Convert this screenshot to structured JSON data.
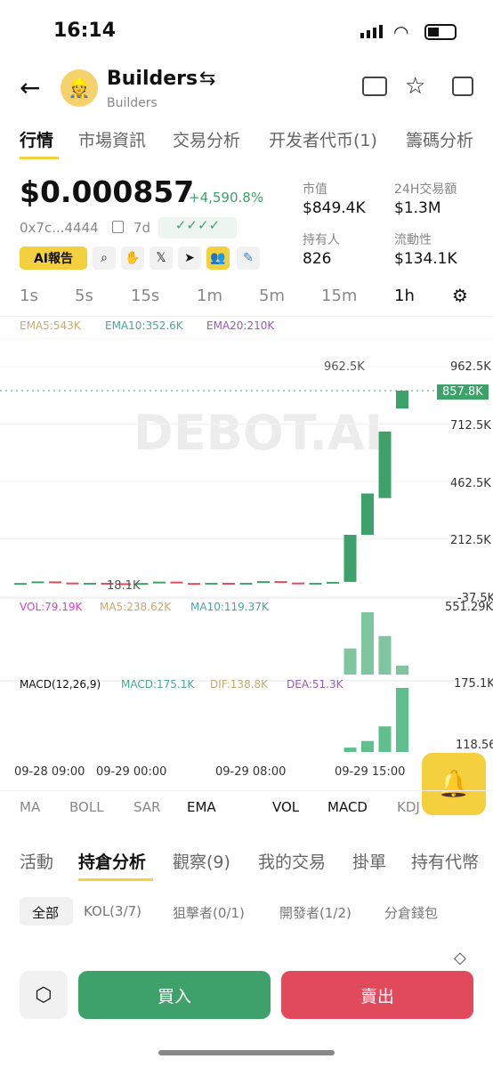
{
  "status": {
    "time": "16:14"
  },
  "header": {
    "title": "Builders",
    "subtitle": "Builders"
  },
  "tabs": [
    "行情",
    "市場資訊",
    "交易分析",
    "开发者代币(1)",
    "籌碼分析"
  ],
  "price": {
    "value": "$0.000857",
    "change": "+4,590.8%",
    "address": "0x7c...4444",
    "age": "7d"
  },
  "stats": {
    "mcap_label": "市值",
    "mcap": "$849.4K",
    "vol_label": "24H交易額",
    "vol": "$1.3M",
    "holders_label": "持有人",
    "holders": "826",
    "liq_label": "流動性",
    "liq": "$134.1K"
  },
  "ai_report": "AI報告",
  "intervals": [
    "1s",
    "5s",
    "15s",
    "1m",
    "5m",
    "15m",
    "1h"
  ],
  "chart": {
    "ema5": "EMA5:543K",
    "ema10": "EMA10:352.6K",
    "ema20": "EMA20:210K",
    "watermark": "DEBOT.AI",
    "yticks": [
      "962.5K",
      "712.5K",
      "462.5K",
      "212.5K",
      "-37.5K"
    ],
    "current": "857.8K",
    "high_label": "962.5K",
    "low_label": "18.1K",
    "vol_legend": "VOL:79.19K",
    "vol_ma5": "MA5:238.62K",
    "vol_ma10": "MA10:119.37K",
    "vol_max": "551.29K",
    "macd": "MACD(12,26,9)",
    "macd_val": "MACD:175.1K",
    "dif": "DIF:138.8K",
    "dea": "DEA:51.3K",
    "macd_max": "175.1K",
    "macd_min": "118.56",
    "xticks": [
      "09-28 09:00",
      "09-29 00:00",
      "09-29 08:00",
      "09-29 15:00"
    ]
  },
  "chart_data": {
    "type": "candlestick",
    "unit": "market cap",
    "candles": [
      {
        "o": 18,
        "c": 20
      },
      {
        "o": 20,
        "c": 27
      },
      {
        "o": 27,
        "c": 22
      },
      {
        "o": 22,
        "c": 18.1
      },
      {
        "o": 18.1,
        "c": 21
      },
      {
        "o": 21,
        "c": 19
      },
      {
        "o": 19,
        "c": 18.5
      },
      {
        "o": 18.5,
        "c": 20
      },
      {
        "o": 20,
        "c": 26
      },
      {
        "o": 26,
        "c": 20
      },
      {
        "o": 20,
        "c": 19
      },
      {
        "o": 19,
        "c": 21
      },
      {
        "o": 21,
        "c": 19
      },
      {
        "o": 19,
        "c": 21
      },
      {
        "o": 21,
        "c": 28
      },
      {
        "o": 28,
        "c": 22
      },
      {
        "o": 22,
        "c": 20
      },
      {
        "o": 20,
        "c": 21
      },
      {
        "o": 21,
        "c": 25
      },
      {
        "o": 25,
        "c": 230
      },
      {
        "o": 230,
        "c": 410
      },
      {
        "o": 390,
        "c": 680
      },
      {
        "o": 780,
        "c": 857.8
      }
    ],
    "volume": [
      0,
      0,
      0,
      0,
      0,
      0,
      0,
      0,
      0,
      0,
      0,
      0,
      0,
      0,
      0,
      0,
      0,
      0,
      0,
      231,
      551.29,
      341,
      79.19
    ],
    "macd": [
      0,
      0,
      0,
      0,
      0,
      0,
      0,
      0,
      0,
      0,
      0,
      0,
      0,
      0,
      0,
      0,
      0,
      0,
      0,
      12,
      30,
      70,
      175.1
    ],
    "ylim": [
      -37.5,
      962.5
    ]
  },
  "indicators": [
    "MA",
    "BOLL",
    "SAR",
    "EMA",
    "VOL",
    "MACD",
    "KDJ"
  ],
  "sections": [
    "活動",
    "持倉分析",
    "觀察(9)",
    "我的交易",
    "掛單",
    "持有代幣"
  ],
  "filters": [
    "全部",
    "KOL(3/7)",
    "狙擊者(0/1)",
    "開發者(1/2)",
    "分倉錢包"
  ],
  "actions": {
    "buy": "買入",
    "sell": "賣出"
  },
  "colors": {
    "up": "#3ea16a",
    "down": "#e04a5a",
    "accent": "#f4d03f"
  }
}
